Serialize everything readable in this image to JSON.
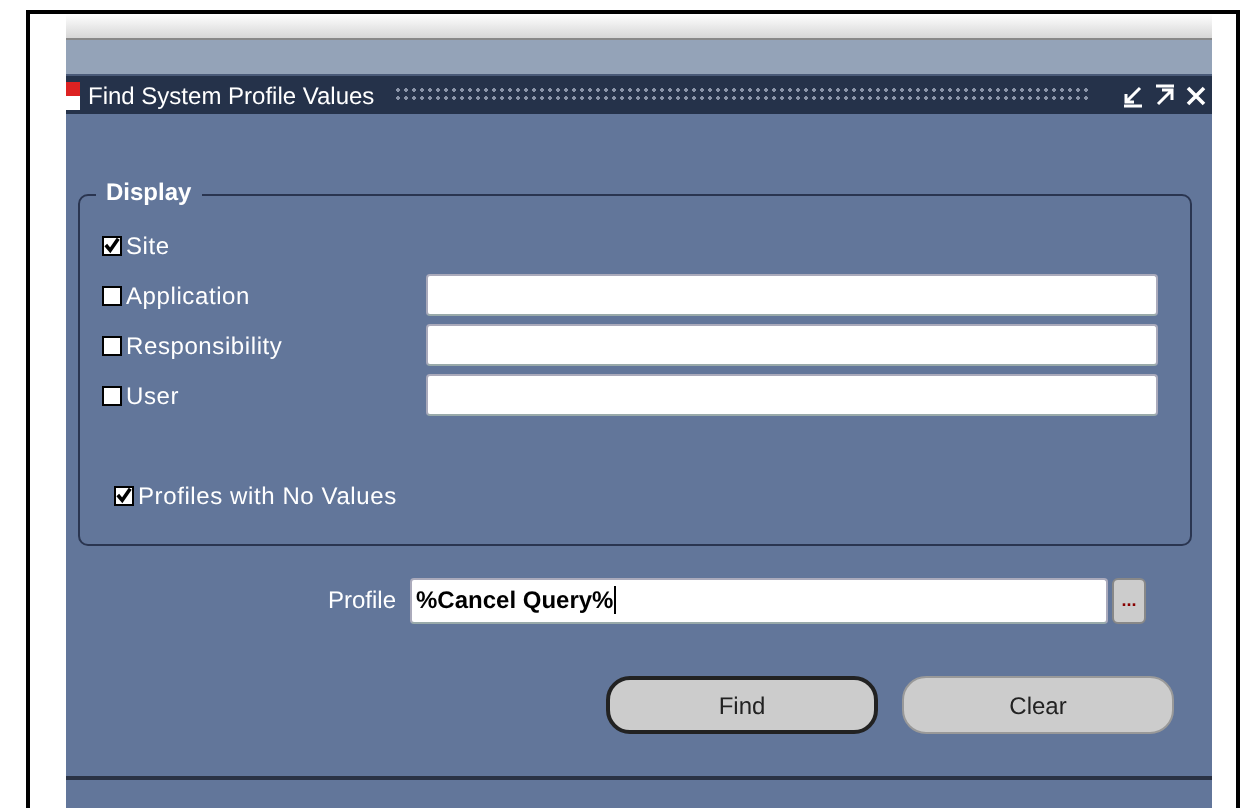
{
  "window": {
    "title": "Find System Profile Values"
  },
  "display": {
    "title": "Display",
    "options": [
      {
        "label": "Site",
        "checked": true,
        "has_field": false
      },
      {
        "label": "Application",
        "checked": false,
        "has_field": true
      },
      {
        "label": "Responsibility",
        "checked": false,
        "has_field": true
      },
      {
        "label": "User",
        "checked": false,
        "has_field": true
      }
    ],
    "profiles_with_no_values": {
      "label": "Profiles with No Values",
      "checked": true
    }
  },
  "profile": {
    "label": "Profile",
    "value": "%Cancel Query%",
    "lov_button": "..."
  },
  "buttons": [
    {
      "label": "Find",
      "default": true
    },
    {
      "label": "Clear",
      "default": false
    }
  ]
}
